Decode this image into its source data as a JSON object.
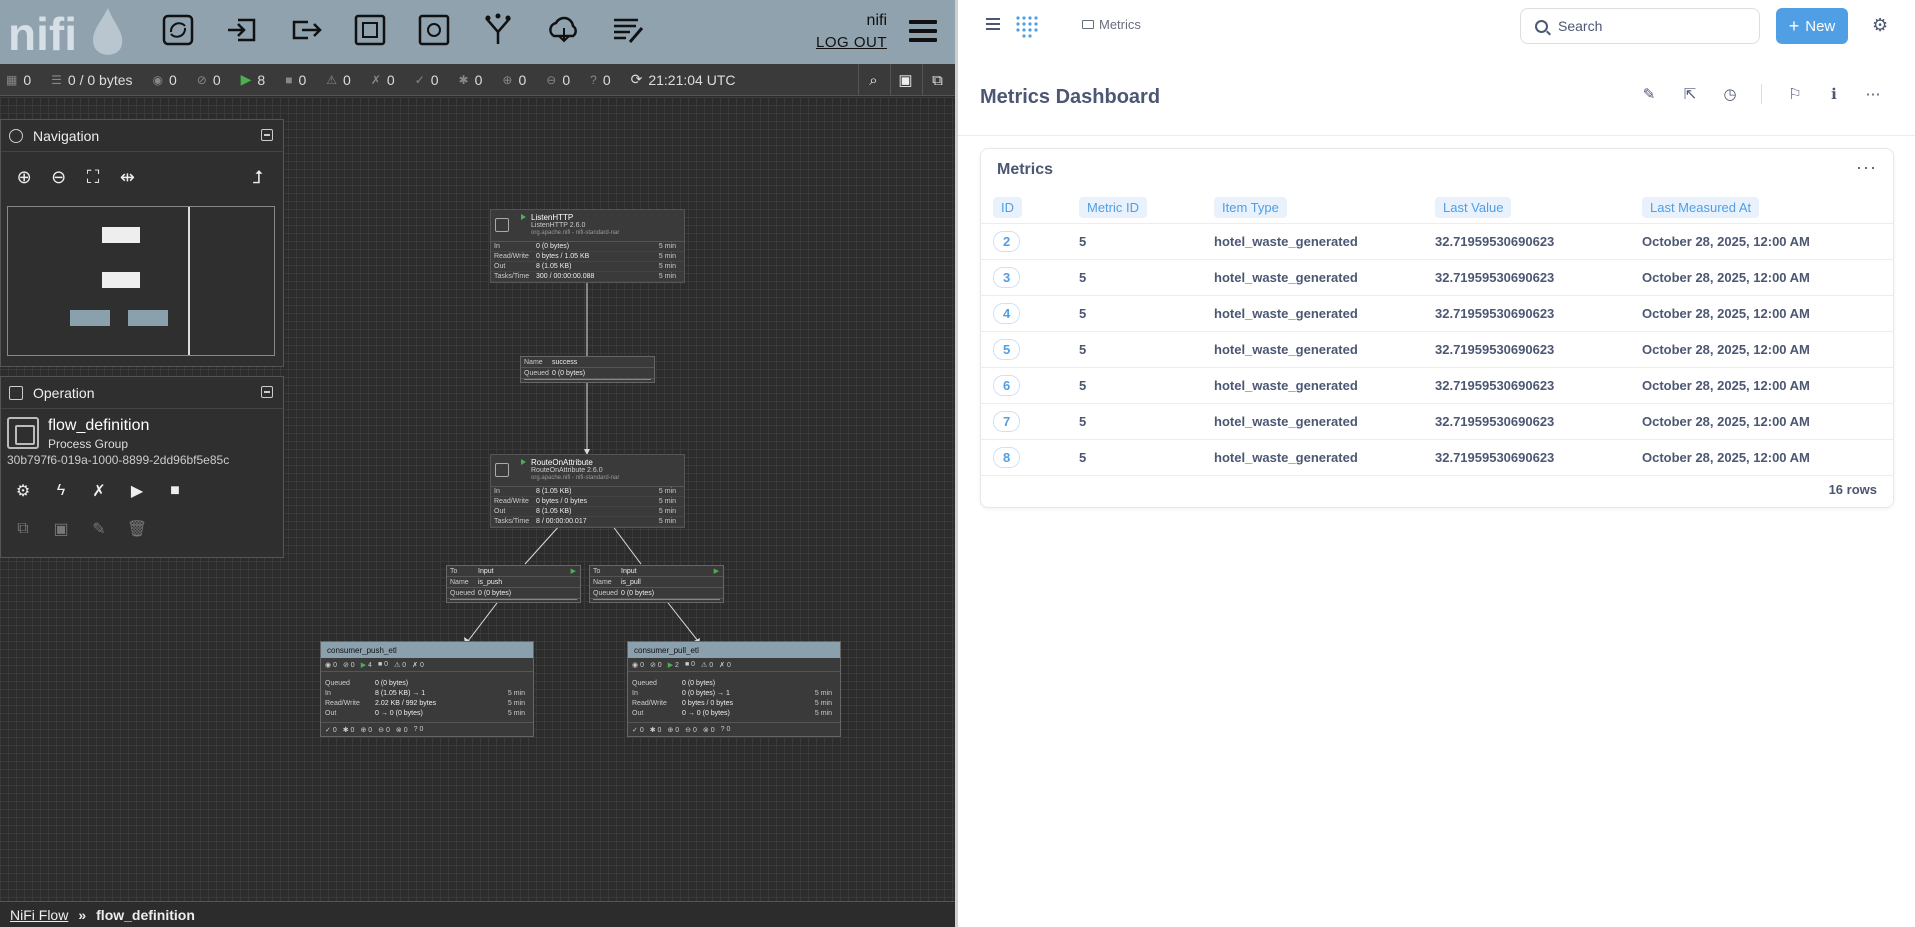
{
  "nifi": {
    "user": "nifi",
    "logout": "LOG OUT",
    "status": {
      "threads": "0",
      "queued": "0 / 0 bytes",
      "transmitting": "0",
      "not_transmitting": "0",
      "running": "8",
      "stopped": "0",
      "invalid": "0",
      "disabled": "0",
      "up_to_date": "0",
      "locally_modified": "0",
      "stale": "0",
      "sync_failure": "0",
      "unknown": "0",
      "time": "21:21:04 UTC"
    },
    "navigation": {
      "title": "Navigation"
    },
    "operation": {
      "title": "Operation",
      "name": "flow_definition",
      "type": "Process Group",
      "id": "30b797f6-019a-1000-8899-2dd96bf5e85c"
    },
    "processors": [
      {
        "name": "ListenHTTP",
        "type": "ListenHTTP 2.6.0",
        "bundle": "org.apache.nifi - nifi-standard-nar",
        "rows": [
          {
            "k": "In",
            "v": "0 (0 bytes)",
            "t": "5 min"
          },
          {
            "k": "Read/Write",
            "v": "0 bytes / 1.05 KB",
            "t": "5 min"
          },
          {
            "k": "Out",
            "v": "8 (1.05 KB)",
            "t": "5 min"
          },
          {
            "k": "Tasks/Time",
            "v": "300 / 00:00:00.088",
            "t": "5 min"
          }
        ]
      },
      {
        "name": "RouteOnAttribute",
        "type": "RouteOnAttribute 2.6.0",
        "bundle": "org.apache.nifi - nifi-standard-nar",
        "rows": [
          {
            "k": "In",
            "v": "8 (1.05 KB)",
            "t": "5 min"
          },
          {
            "k": "Read/Write",
            "v": "0 bytes / 0 bytes",
            "t": "5 min"
          },
          {
            "k": "Out",
            "v": "8 (1.05 KB)",
            "t": "5 min"
          },
          {
            "k": "Tasks/Time",
            "v": "8 / 00:00:00.017",
            "t": "5 min"
          }
        ]
      }
    ],
    "connections": [
      {
        "rows": [
          {
            "k": "Name",
            "v": "success"
          },
          {
            "k": "Queued",
            "v": "0 (0 bytes)"
          }
        ]
      },
      {
        "rows": [
          {
            "k": "To",
            "v": "Input"
          },
          {
            "k": "Name",
            "v": "is_push"
          },
          {
            "k": "Queued",
            "v": "0 (0 bytes)"
          }
        ]
      },
      {
        "rows": [
          {
            "k": "To",
            "v": "Input"
          },
          {
            "k": "Name",
            "v": "is_pull"
          },
          {
            "k": "Queued",
            "v": "0 (0 bytes)"
          }
        ]
      }
    ],
    "groups": [
      {
        "name": "consumer_push_etl",
        "stats": [
          "0",
          "0",
          "4",
          "0",
          "0",
          "0"
        ],
        "rows": [
          {
            "k": "Queued",
            "v": "0 (0 bytes)",
            "t": ""
          },
          {
            "k": "In",
            "v": "8 (1.05 KB) → 1",
            "t": "5 min"
          },
          {
            "k": "Read/Write",
            "v": "2.02 KB / 992 bytes",
            "t": "5 min"
          },
          {
            "k": "Out",
            "v": "0 → 0 (0 bytes)",
            "t": "5 min"
          }
        ],
        "foot": [
          "0",
          "0",
          "0",
          "0",
          "0",
          "0"
        ]
      },
      {
        "name": "consumer_pull_etl",
        "stats": [
          "0",
          "0",
          "2",
          "0",
          "0",
          "0"
        ],
        "rows": [
          {
            "k": "Queued",
            "v": "0 (0 bytes)",
            "t": ""
          },
          {
            "k": "In",
            "v": "0 (0 bytes) → 1",
            "t": "5 min"
          },
          {
            "k": "Read/Write",
            "v": "0 bytes / 0 bytes",
            "t": "5 min"
          },
          {
            "k": "Out",
            "v": "0 → 0 (0 bytes)",
            "t": "5 min"
          }
        ],
        "foot": [
          "0",
          "0",
          "0",
          "0",
          "0",
          "0"
        ]
      }
    ],
    "breadcrumbs": {
      "root": "NiFi Flow",
      "current": "flow_definition"
    }
  },
  "metabase": {
    "breadcrumb": "Metrics",
    "search_placeholder": "Search",
    "new_label": "New",
    "dashboard_title": "Metrics Dashboard",
    "card_title": "Metrics",
    "columns": [
      "ID",
      "Metric ID",
      "Item Type",
      "Last Value",
      "Last Measured At"
    ],
    "rows": [
      [
        "2",
        "5",
        "hotel_waste_generated",
        "32.71959530690623",
        "October 28, 2025, 12:00 AM"
      ],
      [
        "3",
        "5",
        "hotel_waste_generated",
        "32.71959530690623",
        "October 28, 2025, 12:00 AM"
      ],
      [
        "4",
        "5",
        "hotel_waste_generated",
        "32.71959530690623",
        "October 28, 2025, 12:00 AM"
      ],
      [
        "5",
        "5",
        "hotel_waste_generated",
        "32.71959530690623",
        "October 28, 2025, 12:00 AM"
      ],
      [
        "6",
        "5",
        "hotel_waste_generated",
        "32.71959530690623",
        "October 28, 2025, 12:00 AM"
      ],
      [
        "7",
        "5",
        "hotel_waste_generated",
        "32.71959530690623",
        "October 28, 2025, 12:00 AM"
      ],
      [
        "8",
        "5",
        "hotel_waste_generated",
        "32.71959530690623",
        "October 28, 2025, 12:00 AM"
      ]
    ],
    "row_count": "16 rows",
    "accent": "#509ee3"
  }
}
